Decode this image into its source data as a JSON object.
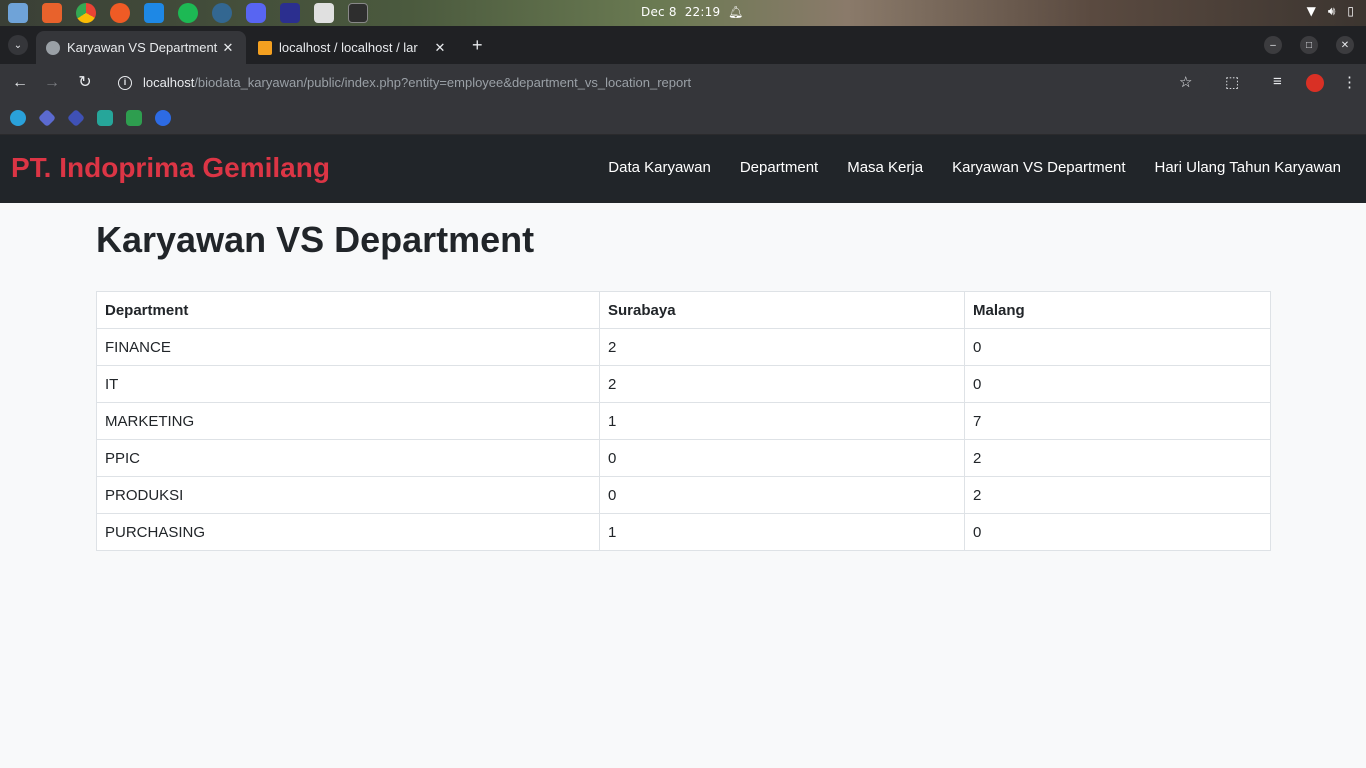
{
  "os": {
    "date": "Dec 8",
    "time": "22:19",
    "apps": [
      {
        "name": "files-icon",
        "color": "#6fa3d8"
      },
      {
        "name": "app-store-icon",
        "color": "#e8622c"
      },
      {
        "name": "chrome-icon",
        "color": "#4285f4"
      },
      {
        "name": "postman-icon",
        "color": "#ef5b25"
      },
      {
        "name": "vscode-icon",
        "color": "#1e88e5"
      },
      {
        "name": "spotify-icon",
        "color": "#1db954"
      },
      {
        "name": "pgadmin-icon",
        "color": "#336791"
      },
      {
        "name": "discord-icon",
        "color": "#5865f2"
      },
      {
        "name": "intellij-icon",
        "color": "#2b2f8f"
      },
      {
        "name": "document-viewer-icon",
        "color": "#e0e0e0"
      },
      {
        "name": "terminal-icon",
        "color": "#2e2e2e"
      }
    ]
  },
  "browser": {
    "tabs": [
      {
        "title": "Karyawan VS Department",
        "active": true
      },
      {
        "title": "localhost / localhost / lar",
        "active": false
      }
    ],
    "url_host": "localhost",
    "url_path": "/biodata_karyawan/public/index.php?entity=employee&department_vs_location_report"
  },
  "site": {
    "brand": "PT. Indoprima Gemilang",
    "nav": [
      "Data Karyawan",
      "Department",
      "Masa Kerja",
      "Karyawan VS Department",
      "Hari Ulang Tahun Karyawan"
    ]
  },
  "page": {
    "title": "Karyawan VS Department",
    "table": {
      "headers": [
        "Department",
        "Surabaya",
        "Malang"
      ],
      "rows": [
        [
          "FINANCE",
          "2",
          "0"
        ],
        [
          "IT",
          "2",
          "0"
        ],
        [
          "MARKETING",
          "1",
          "7"
        ],
        [
          "PPIC",
          "0",
          "2"
        ],
        [
          "PRODUKSI",
          "0",
          "2"
        ],
        [
          "PURCHASING",
          "1",
          "0"
        ]
      ]
    }
  },
  "colors": {
    "brand": "#dc3545",
    "navbar": "#212529",
    "page_bg": "#f8f9fa"
  }
}
